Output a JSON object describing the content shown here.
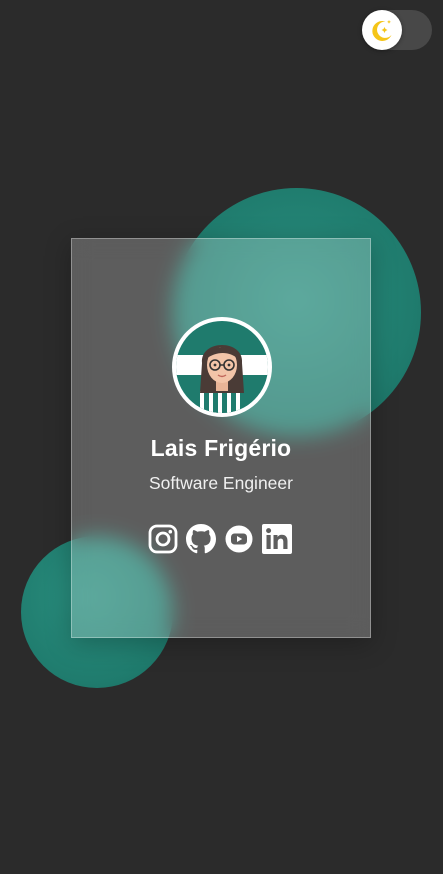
{
  "theme_toggle": {
    "icon": "moon-stars-icon",
    "state": "dark"
  },
  "profile": {
    "name": "Lais Frigério",
    "title": "Software Engineer",
    "avatar_icon": "avatar-illustration"
  },
  "socials": [
    {
      "icon": "instagram-icon"
    },
    {
      "icon": "github-icon"
    },
    {
      "icon": "youtube-icon"
    },
    {
      "icon": "linkedin-icon"
    }
  ],
  "colors": {
    "background": "#2b2b2b",
    "accent": "#1f7b6d",
    "toggle_track": "#484848",
    "moon": "#f5c518"
  }
}
